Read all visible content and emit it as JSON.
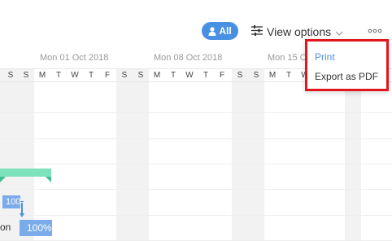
{
  "toolbar": {
    "filter_label": "All",
    "view_options_label": "View options"
  },
  "timeline": {
    "weeks": [
      {
        "label": "Mon 01 Oct 2018"
      },
      {
        "label": "Mon 08 Oct 2018"
      },
      {
        "label": "Mon 15 O"
      }
    ],
    "days": [
      "S",
      "S",
      "M",
      "T",
      "W",
      "T",
      "F",
      "S",
      "S",
      "M",
      "T",
      "W",
      "T",
      "F",
      "S",
      "S",
      "M",
      "T",
      "W"
    ]
  },
  "tasks": [
    {
      "label": "100",
      "progress_percent": 100
    },
    {
      "label": "100%",
      "progress_percent": 100,
      "name_fragment": "on"
    }
  ],
  "menu": {
    "items": [
      {
        "label": "Print"
      },
      {
        "label": "Export as PDF"
      }
    ]
  },
  "colors": {
    "accent": "#4a90e2",
    "highlight_border": "#e0161f",
    "milestone_green": "#7ee2bd",
    "task_bar": "#7aabea"
  }
}
